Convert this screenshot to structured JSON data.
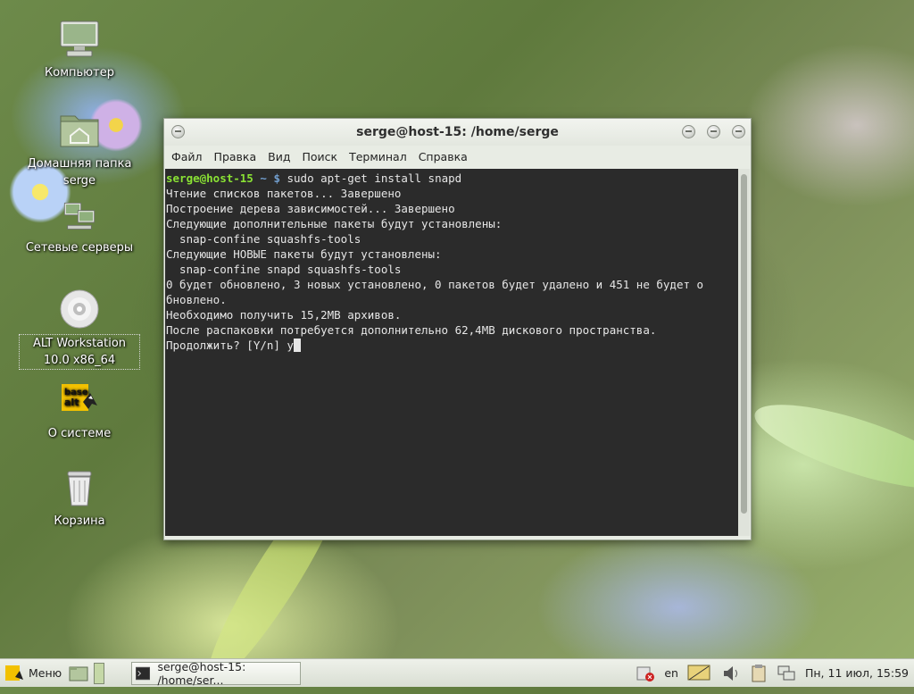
{
  "desktop": {
    "icons": [
      {
        "label": "Компьютер"
      },
      {
        "label": "Домашняя папка serge"
      },
      {
        "label": "Сетевые серверы"
      },
      {
        "label": "ALT Workstation 10.0 x86_64"
      },
      {
        "label": "О системе"
      },
      {
        "label": "Корзина"
      }
    ],
    "logo_text": [
      "base",
      "alt"
    ]
  },
  "window": {
    "title": "serge@host-15: /home/serge",
    "menu": [
      "Файл",
      "Правка",
      "Вид",
      "Поиск",
      "Терминал",
      "Справка"
    ],
    "terminal": {
      "prompt_user": "serge@host-15",
      "prompt_dir": "~",
      "prompt_symbol": "$",
      "command": "sudo apt-get install snapd",
      "lines": [
        "Чтение списков пакетов... Завершено",
        "Построение дерева зависимостей... Завершено",
        "Следующие дополнительные пакеты будут установлены:",
        "  snap-confine squashfs-tools",
        "Следующие НОВЫЕ пакеты будут установлены:",
        "  snap-confine snapd squashfs-tools",
        "0 будет обновлено, 3 новых установлено, 0 пакетов будет удалено и 451 не будет о",
        "бновлено.",
        "Необходимо получить 15,2MB архивов.",
        "После распаковки потребуется дополнительно 62,4MB дискового пространства."
      ],
      "last_prompt": "Продолжить? [Y/n] y"
    }
  },
  "taskbar": {
    "menu_label": "Меню",
    "task_label": "serge@host-15: /home/ser...",
    "keyboard_layout": "en",
    "clock": "Пн, 11 июл, 15:59"
  }
}
